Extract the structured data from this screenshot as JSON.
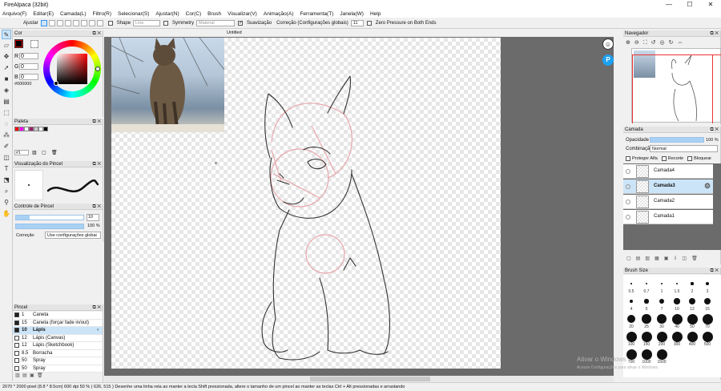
{
  "window": {
    "title": "FireAlpaca (32bit)",
    "controls": [
      "—",
      "☐",
      "✕"
    ]
  },
  "menu": [
    "Arquivo(F)",
    "Editar(E)",
    "Camada(L)",
    "Filtro(R)",
    "Selecionar(S)",
    "Ajustar(N)",
    "Cor(C)",
    "Brush",
    "Visualizar(V)",
    "Animação(A)",
    "Ferramenta(T)",
    "Janela(W)",
    "Help"
  ],
  "toolopts": {
    "adjust_label": "Ajustar",
    "shape_label": "Shape",
    "shape_value": "Line",
    "symmetry_label": "Symmetry",
    "symmetry_value": "Material",
    "stabilizer_label": "Suavização",
    "correction_label": "Correção (Configurações globais)",
    "correction_value": "11",
    "zero_pressure_label": "Zero Pressure on Both Ends"
  },
  "tools": [
    "brush-tool",
    "eraser-tool",
    "move-tool",
    "fill-tool",
    "gradient-tool",
    "bucket-tool",
    "rect-select",
    "lasso-select",
    "magic-wand",
    "select-pen",
    "select-eraser",
    "zoom-tool",
    "text-tool",
    "hand-tool",
    "eyedropper-tool",
    "dot-tool"
  ],
  "color_panel": {
    "title": "Cor",
    "r_label": "R",
    "r_value": "0",
    "g_label": "G",
    "g_value": "0",
    "b_label": "B",
    "b_value": "0",
    "hex": "#000000",
    "fg_color": "#000000",
    "bg_color": "#ffffff"
  },
  "palette_panel": {
    "title": "Paleta",
    "swatches": [
      "#ff0000",
      "#ff00ff",
      "#ffffff",
      "#9b1c6a",
      "#cccccc",
      "#ffffff",
      "#000000"
    ],
    "palette_index": "#1"
  },
  "preview_panel": {
    "title": "Visualização do Pincel"
  },
  "brush_control": {
    "title": "Controle de Pincel",
    "size_value": "10",
    "opacity_value": "100 %",
    "correction_label": "Correção",
    "correction_select": "Use configurações globai"
  },
  "brush_list": {
    "title": "Pincel",
    "items": [
      {
        "size": "1",
        "name": "Caneta",
        "dark": true,
        "active": false
      },
      {
        "size": "15",
        "name": "Caneta (forçar fade in/out)",
        "dark": true,
        "active": false
      },
      {
        "size": "10",
        "name": "Lápis",
        "dark": true,
        "active": true
      },
      {
        "size": "12",
        "name": "Lápis (Canvas)",
        "dark": false,
        "active": false
      },
      {
        "size": "12",
        "name": "Lápis (Sketchbook)",
        "dark": false,
        "active": false
      },
      {
        "size": "8.5",
        "name": "Borracha",
        "dark": false,
        "active": false
      },
      {
        "size": "50",
        "name": "Spray",
        "dark": false,
        "active": false
      },
      {
        "size": "50",
        "name": "Spray",
        "dark": false,
        "active": false
      }
    ]
  },
  "canvas": {
    "doc_title": "Untitled"
  },
  "navigator": {
    "title": "Navegador"
  },
  "layers": {
    "title": "Camada",
    "opacity_label": "Opacidade",
    "opacity_value": "100 %",
    "opacity_fraction": 1.0,
    "blend_label": "Combinação",
    "blend_value": "Normal",
    "protect_alpha": "Proteger Alfa",
    "clipping": "Recorte",
    "lock": "Bloquear",
    "items": [
      {
        "name": "Camada4",
        "active": false
      },
      {
        "name": "Camada3",
        "active": true
      },
      {
        "name": "Camada2",
        "active": false
      },
      {
        "name": "Camada1",
        "active": false
      }
    ]
  },
  "brush_size": {
    "title": "Brush Size",
    "sizes": [
      "0.5",
      "0.7",
      "1",
      "1.5",
      "2",
      "3",
      "4",
      "5",
      "7",
      "10",
      "12",
      "15",
      "20",
      "25",
      "30",
      "40",
      "50",
      "70",
      "100",
      "150",
      "200",
      "300",
      "400",
      "500",
      "700",
      "1000",
      "1500"
    ]
  },
  "watermark": {
    "line1": "Ativar o Windows",
    "line2": "Acesse Configurações para ativar o Windows."
  },
  "status": {
    "text": "2070 * 2000 pixel  (8.8 * 8.5cm)  600 dpi  50 %  ( 626, 515 )   Desenhe uma linha reta ao manter a tecla Shift pressionada, altere o tamanho de um pincel ao manter as teclas Ctrl + Alt pressionadas e arrastando"
  }
}
